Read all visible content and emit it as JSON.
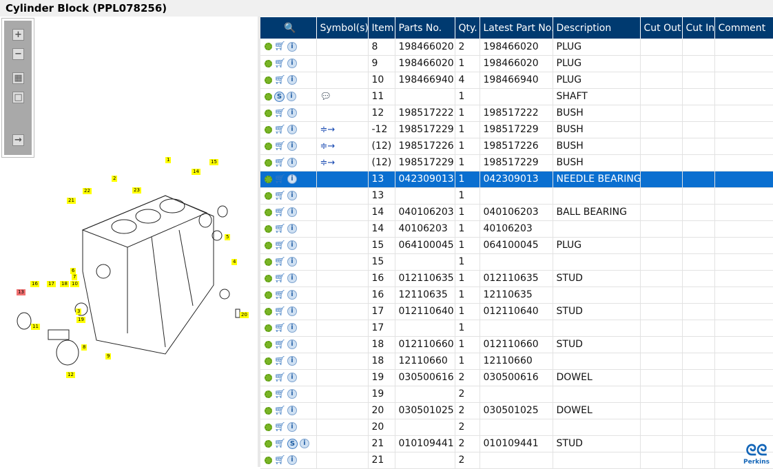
{
  "title": "Cylinder Block (PPL078256)",
  "headers": [
    "",
    "Symbol(s)",
    "Item",
    "Parts No.",
    "Qty.",
    "Latest Part No.",
    "Description",
    "Cut Out",
    "Cut In",
    "Comment"
  ],
  "rows": [
    {
      "icons": "cart",
      "symbol": "",
      "item": "8",
      "part": "198466020",
      "qty": "2",
      "latest": "198466020",
      "desc": "PLUG"
    },
    {
      "icons": "cart",
      "symbol": "",
      "item": "9",
      "part": "198466020",
      "qty": "1",
      "latest": "198466020",
      "desc": "PLUG"
    },
    {
      "icons": "cart",
      "symbol": "",
      "item": "10",
      "part": "198466940",
      "qty": "4",
      "latest": "198466940",
      "desc": "PLUG"
    },
    {
      "icons": "s",
      "symbol": "comment",
      "item": "11",
      "part": "",
      "qty": "1",
      "latest": "",
      "desc": "SHAFT"
    },
    {
      "icons": "cart",
      "symbol": "",
      "item": "12",
      "part": "198517222",
      "qty": "1",
      "latest": "198517222",
      "desc": "BUSH"
    },
    {
      "icons": "cart",
      "symbol": "interchange",
      "item": "-12",
      "part": "198517229",
      "qty": "1",
      "latest": "198517229",
      "desc": "BUSH"
    },
    {
      "icons": "cart",
      "symbol": "interchange",
      "item": "(12)",
      "part": "198517226",
      "qty": "1",
      "latest": "198517226",
      "desc": "BUSH"
    },
    {
      "icons": "cart",
      "symbol": "interchange",
      "item": "(12)",
      "part": "198517229",
      "qty": "1",
      "latest": "198517229",
      "desc": "BUSH"
    },
    {
      "icons": "cart",
      "symbol": "",
      "item": "13",
      "part": "042309013",
      "qty": "1",
      "latest": "042309013",
      "desc": "NEEDLE BEARING",
      "selected": true
    },
    {
      "icons": "cart",
      "symbol": "",
      "item": "13",
      "part": "",
      "qty": "1",
      "latest": "",
      "desc": ""
    },
    {
      "icons": "cart",
      "symbol": "",
      "item": "14",
      "part": "040106203",
      "qty": "1",
      "latest": "040106203",
      "desc": "BALL BEARING"
    },
    {
      "icons": "cart",
      "symbol": "",
      "item": "14",
      "part": "40106203",
      "qty": "1",
      "latest": "40106203",
      "desc": ""
    },
    {
      "icons": "cart",
      "symbol": "",
      "item": "15",
      "part": "064100045",
      "qty": "1",
      "latest": "064100045",
      "desc": "PLUG"
    },
    {
      "icons": "cart",
      "symbol": "",
      "item": "15",
      "part": "",
      "qty": "1",
      "latest": "",
      "desc": ""
    },
    {
      "icons": "cart",
      "symbol": "",
      "item": "16",
      "part": "012110635",
      "qty": "1",
      "latest": "012110635",
      "desc": "STUD"
    },
    {
      "icons": "cart",
      "symbol": "",
      "item": "16",
      "part": "12110635",
      "qty": "1",
      "latest": "12110635",
      "desc": ""
    },
    {
      "icons": "cart",
      "symbol": "",
      "item": "17",
      "part": "012110640",
      "qty": "1",
      "latest": "012110640",
      "desc": "STUD"
    },
    {
      "icons": "cart",
      "symbol": "",
      "item": "17",
      "part": "",
      "qty": "1",
      "latest": "",
      "desc": ""
    },
    {
      "icons": "cart",
      "symbol": "",
      "item": "18",
      "part": "012110660",
      "qty": "1",
      "latest": "012110660",
      "desc": "STUD"
    },
    {
      "icons": "cart",
      "symbol": "",
      "item": "18",
      "part": "12110660",
      "qty": "1",
      "latest": "12110660",
      "desc": ""
    },
    {
      "icons": "cart",
      "symbol": "",
      "item": "19",
      "part": "030500616",
      "qty": "2",
      "latest": "030500616",
      "desc": "DOWEL"
    },
    {
      "icons": "cart",
      "symbol": "",
      "item": "19",
      "part": "",
      "qty": "2",
      "latest": "",
      "desc": ""
    },
    {
      "icons": "cart",
      "symbol": "",
      "item": "20",
      "part": "030501025",
      "qty": "2",
      "latest": "030501025",
      "desc": "DOWEL"
    },
    {
      "icons": "cart",
      "symbol": "",
      "item": "20",
      "part": "",
      "qty": "2",
      "latest": "",
      "desc": ""
    },
    {
      "icons": "cart-s",
      "symbol": "",
      "item": "21",
      "part": "010109441",
      "qty": "2",
      "latest": "010109441",
      "desc": "STUD"
    },
    {
      "icons": "cart",
      "symbol": "",
      "item": "21",
      "part": "",
      "qty": "2",
      "latest": "",
      "desc": ""
    }
  ],
  "callouts": [
    "1",
    "2",
    "22",
    "23",
    "21",
    "14",
    "15",
    "5",
    "4",
    "6",
    "7",
    "10",
    "13",
    "16",
    "17",
    "18",
    "3",
    "19",
    "11",
    "8",
    "9",
    "12",
    "20"
  ],
  "logo": "Perkins"
}
